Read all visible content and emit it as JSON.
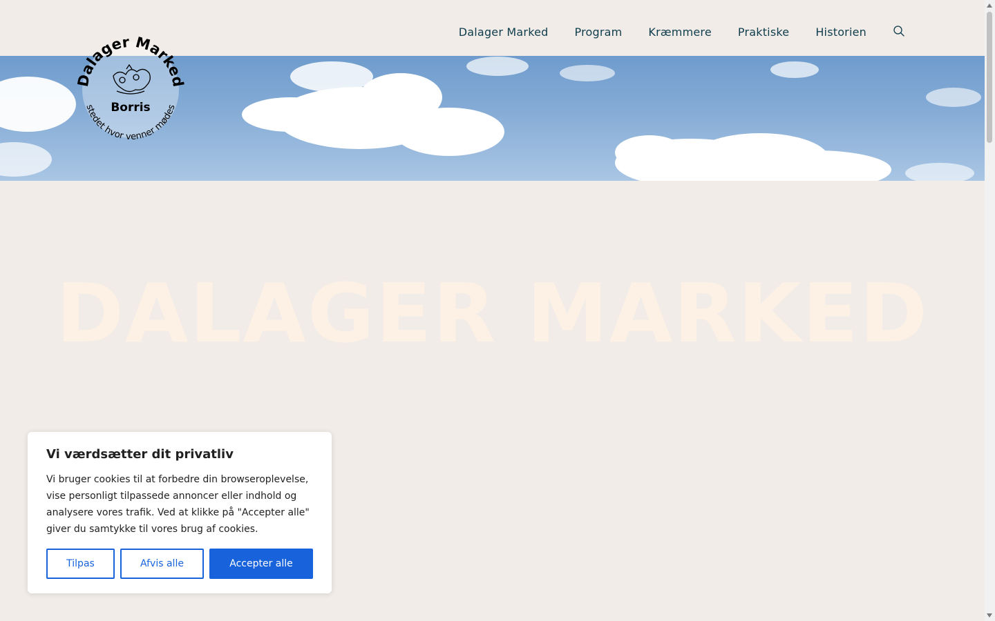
{
  "nav": {
    "items": [
      {
        "label": "Dalager Marked"
      },
      {
        "label": "Program"
      },
      {
        "label": "Kræmmere"
      },
      {
        "label": "Praktiske"
      },
      {
        "label": "Historien"
      }
    ],
    "search_icon": "search-icon"
  },
  "logo": {
    "top_text": "Dalager Marked",
    "center_text": "Borris",
    "bottom_text": "stedet hvor venner mødes"
  },
  "hero": {
    "title": "DALAGER MARKED"
  },
  "cookie": {
    "title": "Vi værdsætter dit privatliv",
    "body": "Vi bruger cookies til at forbedre din browseroplevelse, vise personligt tilpassede annoncer eller indhold og analysere vores trafik. Ved at klikke på \"Accepter alle\" giver du samtykke til vores brug af cookies.",
    "customize_label": "Tilpas",
    "reject_label": "Afvis alle",
    "accept_label": "Accepter alle"
  },
  "colors": {
    "background": "#f1ece7",
    "nav_text": "#0f3d4d",
    "accent": "#1863dc",
    "hero_text": "#fdf1e6"
  }
}
